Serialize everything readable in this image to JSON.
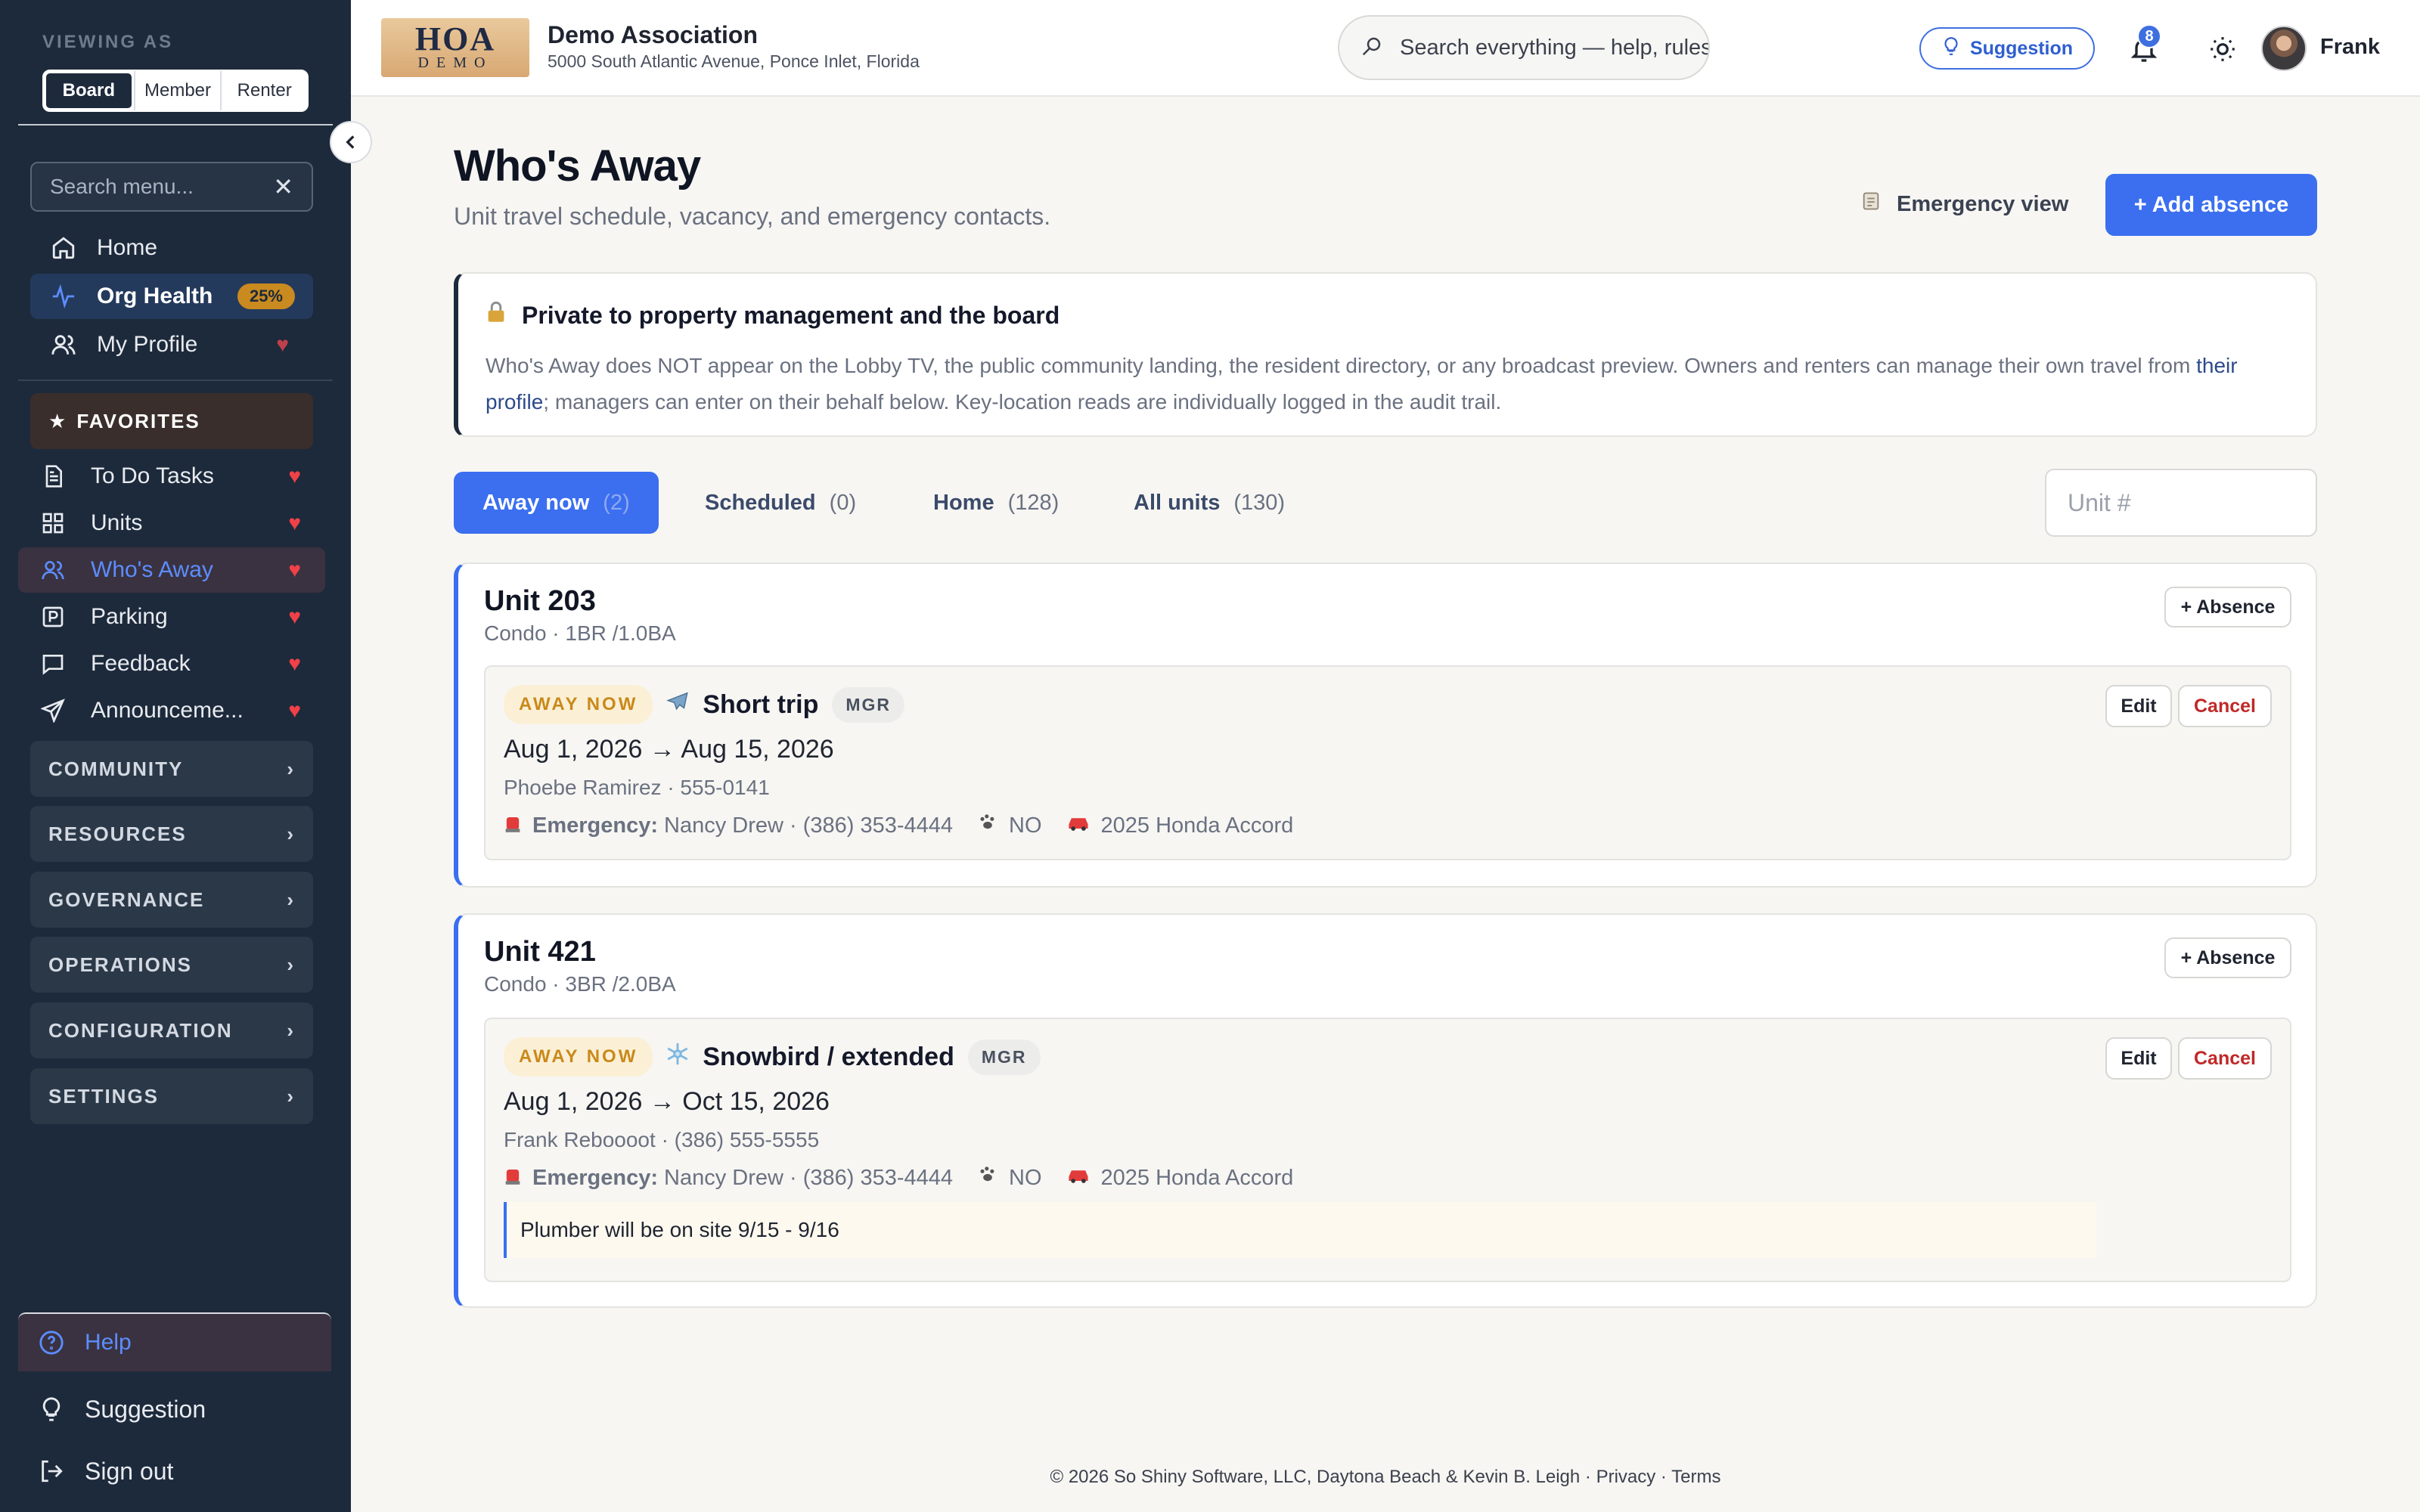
{
  "sidebar": {
    "viewing_as": "VIEWING AS",
    "roles": [
      "Board",
      "Member",
      "Renter"
    ],
    "active_role": "Board",
    "search_placeholder": "Search menu...",
    "nav": [
      {
        "label": "Home",
        "icon": "home-icon"
      },
      {
        "label": "Org Health",
        "icon": "activity-icon",
        "badge": "25%"
      },
      {
        "label": "My Profile",
        "icon": "user-icon"
      }
    ],
    "favorites_label": "FAVORITES",
    "favorites": [
      {
        "label": "To Do Tasks",
        "icon": "document-icon"
      },
      {
        "label": "Units",
        "icon": "grid-icon"
      },
      {
        "label": "Who's Away",
        "icon": "users-icon"
      },
      {
        "label": "Parking",
        "icon": "parking-icon"
      },
      {
        "label": "Feedback",
        "icon": "chat-icon"
      },
      {
        "label": "Announceme...",
        "icon": "send-icon"
      }
    ],
    "groups": [
      "COMMUNITY",
      "RESOURCES",
      "GOVERNANCE",
      "OPERATIONS",
      "CONFIGURATION",
      "SETTINGS"
    ],
    "help": "Help",
    "suggestion": "Suggestion",
    "sign_out": "Sign out"
  },
  "header": {
    "logo_line1": "HOA",
    "logo_line2": "DEMO",
    "association": "Demo Association",
    "address": "5000 South Atlantic Avenue, Ponce Inlet, Florida",
    "search_placeholder": "Search everything — help, rules, docs, mem",
    "suggestion_label": "Suggestion",
    "notification_count": "8",
    "user": "Frank"
  },
  "page": {
    "title": "Who's Away",
    "subtitle": "Unit travel schedule, vacancy, and emergency contacts.",
    "emergency_view": "Emergency view",
    "add_absence": "+ Add absence"
  },
  "notice": {
    "title": "Private to property management and the board",
    "body_1": "Who's Away does NOT appear on the Lobby TV, the public community landing, the resident directory, or any broadcast preview. Owners and renters can manage their own travel from ",
    "link": "their profile",
    "body_2": "; managers can enter on their behalf below. Key-location reads are individually logged in the audit trail."
  },
  "tabs": [
    {
      "label": "Away now",
      "count": "(2)"
    },
    {
      "label": "Scheduled",
      "count": "(0)"
    },
    {
      "label": "Home",
      "count": "(128)"
    },
    {
      "label": "All units",
      "count": "(130)"
    }
  ],
  "unit_filter_placeholder": "Unit #",
  "units": [
    {
      "title": "Unit 203",
      "meta": "Condo · 1BR /1.0BA",
      "absence_btn": "+ Absence",
      "status": "AWAY NOW",
      "trip_icon": "airplane-icon",
      "trip_type": "Short trip",
      "badge": "MGR",
      "dates": "Aug 1, 2026 → Aug 15, 2026",
      "person": "Phoebe Ramirez · 555-0141",
      "emergency_label": "Emergency:",
      "emergency": "Nancy Drew · (386) 353-4444",
      "pets": "NO",
      "vehicle": "2025 Honda Accord",
      "edit": "Edit",
      "cancel": "Cancel"
    },
    {
      "title": "Unit 421",
      "meta": "Condo · 3BR /2.0BA",
      "absence_btn": "+ Absence",
      "status": "AWAY NOW",
      "trip_icon": "snowflake-icon",
      "trip_type": "Snowbird / extended",
      "badge": "MGR",
      "dates": "Aug 1, 2026 → Oct 15, 2026",
      "person": "Frank Reboooot · (386) 555-5555",
      "emergency_label": "Emergency:",
      "emergency": "Nancy Drew · (386) 353-4444",
      "pets": "NO",
      "vehicle": "2025 Honda Accord",
      "edit": "Edit",
      "cancel": "Cancel",
      "note": "Plumber will be on site 9/15 - 9/16"
    }
  ],
  "footer": "© 2026 So Shiny Software, LLC, Daytona Beach & Kevin B. Leigh · Privacy · Terms",
  "colors": {
    "accent": "#3b6ff0",
    "sidebar": "#1d2a3b",
    "away_badge": "#c9891a",
    "danger": "#c02929",
    "heart": "#f04148"
  }
}
